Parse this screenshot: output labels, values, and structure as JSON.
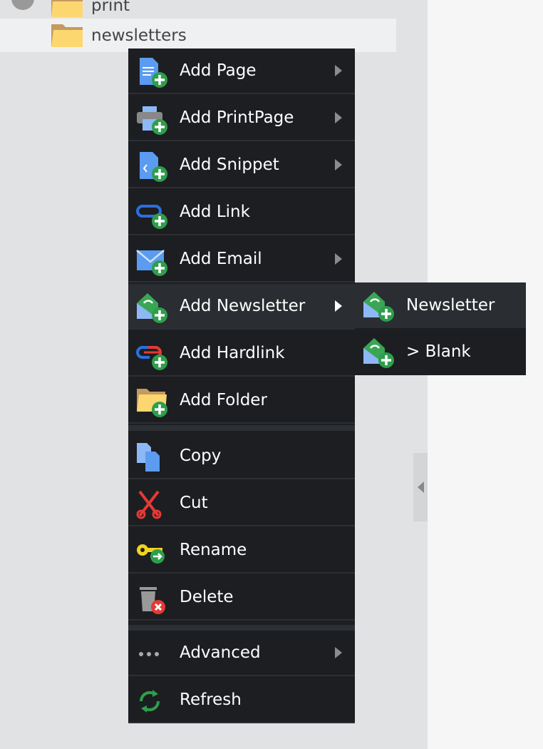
{
  "tree": {
    "items": [
      {
        "label": "print"
      },
      {
        "label": "newsletters",
        "selected": true
      }
    ]
  },
  "context_menu": {
    "items": [
      {
        "label": "Add Page",
        "icon": "page-add-icon",
        "submenu": true
      },
      {
        "label": "Add PrintPage",
        "icon": "printer-add-icon",
        "submenu": true
      },
      {
        "label": "Add Snippet",
        "icon": "snippet-add-icon",
        "submenu": true
      },
      {
        "label": "Add Link",
        "icon": "link-add-icon",
        "submenu": false
      },
      {
        "label": "Add Email",
        "icon": "email-add-icon",
        "submenu": true
      },
      {
        "label": "Add Newsletter",
        "icon": "newsletter-add-icon",
        "submenu": true,
        "active": true
      },
      {
        "label": "Add Hardlink",
        "icon": "hardlink-add-icon",
        "submenu": false
      },
      {
        "label": "Add Folder",
        "icon": "folder-add-icon",
        "submenu": false
      },
      {
        "label": "Copy",
        "icon": "copy-icon",
        "submenu": false
      },
      {
        "label": "Cut",
        "icon": "scissors-icon",
        "submenu": false
      },
      {
        "label": "Rename",
        "icon": "key-rename-icon",
        "submenu": false
      },
      {
        "label": "Delete",
        "icon": "trash-delete-icon",
        "submenu": false
      },
      {
        "label": "Advanced",
        "icon": "more-dots-icon",
        "submenu": true
      },
      {
        "label": "Refresh",
        "icon": "refresh-icon",
        "submenu": false
      }
    ]
  },
  "submenu": {
    "items": [
      {
        "label": "Newsletter",
        "active": true
      },
      {
        "label": "> Blank"
      }
    ]
  },
  "colors": {
    "menu_bg": "#1c1e21",
    "menu_hover": "#2a2d31",
    "green": "#2e9e4c",
    "blue": "#5b9bf0"
  }
}
